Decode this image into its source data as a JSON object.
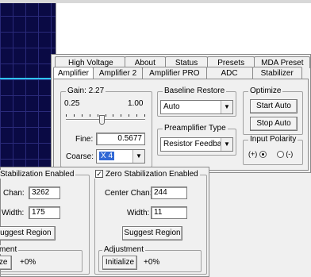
{
  "tabs_row1": [
    "High Voltage",
    "About",
    "Status",
    "Presets",
    "MDA Preset"
  ],
  "tabs_row2": [
    "Amplifier",
    "Amplifier 2",
    "Amplifier PRO",
    "ADC",
    "Stabilizer"
  ],
  "active_tab": "Amplifier",
  "gain": {
    "legend": "Gain: 2.27",
    "min_label": "0.25",
    "max_label": "1.00",
    "slider_fraction": 0.45,
    "fine_label": "Fine:",
    "fine_value": "0.5677",
    "coarse_label": "Coarse:",
    "coarse_value": "X 4"
  },
  "baseline": {
    "legend": "Baseline Restore",
    "value": "Auto"
  },
  "preamp": {
    "legend": "Preamplifier Type",
    "value": "Resistor Feedback"
  },
  "optimize": {
    "legend": "Optimize",
    "start": "Start Auto",
    "stop": "Stop Auto"
  },
  "polarity": {
    "legend": "Input Polarity",
    "pos": "(+)",
    "neg": "(-)"
  },
  "left_panel": {
    "legend": "Stabilization Enabled",
    "chan_label": "Chan:",
    "chan_value": "3262",
    "width_label": "Width:",
    "width_value": "175",
    "suggest": "Suggest Region",
    "adjust_legend": "ment",
    "init": "ize",
    "offset": "+0%"
  },
  "right_panel": {
    "legend": "Zero Stabilization Enabled",
    "chan_label": "Center Chan:",
    "chan_value": "244",
    "width_label": "Width:",
    "width_value": "11",
    "suggest": "Suggest Region",
    "adjust_legend": "Adjustment",
    "init": "Initialize",
    "offset": "+0%"
  }
}
